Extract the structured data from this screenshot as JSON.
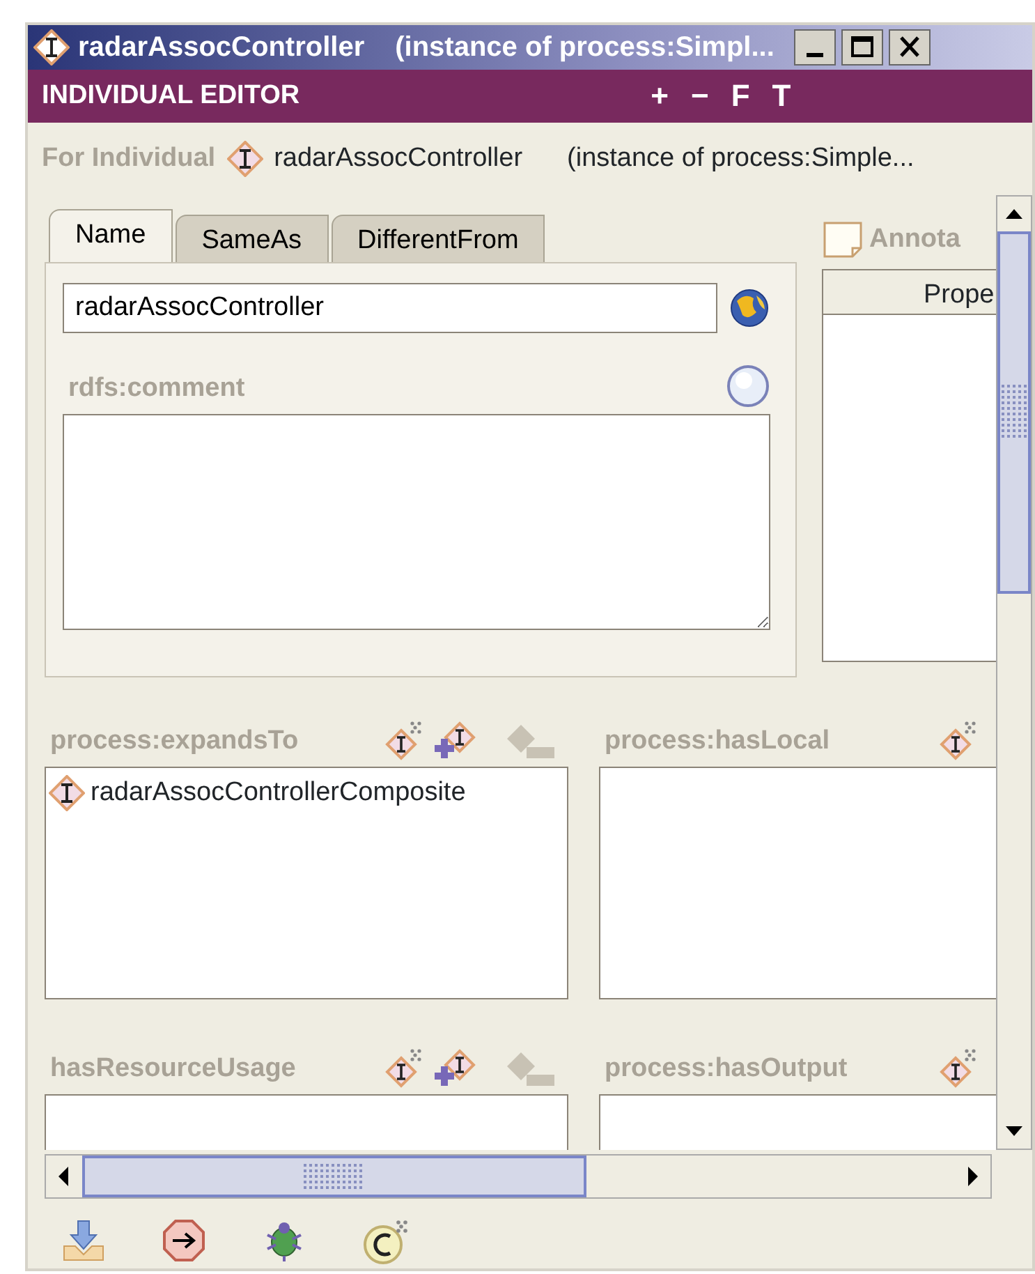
{
  "window": {
    "title": "radarAssocController",
    "subtitle": "(instance of process:Simpl..."
  },
  "header": {
    "title": "INDIVIDUAL EDITOR",
    "buttons": [
      "+",
      "−",
      "F",
      "T"
    ]
  },
  "for_individual": {
    "label": "For Individual",
    "name": "radarAssocController",
    "type": "(instance of process:Simple..."
  },
  "tabs": [
    {
      "label": "Name",
      "selected": true
    },
    {
      "label": "SameAs",
      "selected": false
    },
    {
      "label": "DifferentFrom",
      "selected": false
    }
  ],
  "name_field": {
    "value": "radarAssocController"
  },
  "comment": {
    "label": "rdfs:comment"
  },
  "annotations": {
    "label": "Annota",
    "column": "Prope"
  },
  "properties": [
    {
      "label": "process:expandsTo",
      "kind": "full",
      "items": [
        "radarAssocControllerComposite"
      ]
    },
    {
      "label": "process:hasLocal",
      "kind": "cut"
    },
    {
      "label": "hasResourceUsage",
      "kind": "full"
    },
    {
      "label": "process:hasOutput",
      "kind": "cut"
    }
  ]
}
